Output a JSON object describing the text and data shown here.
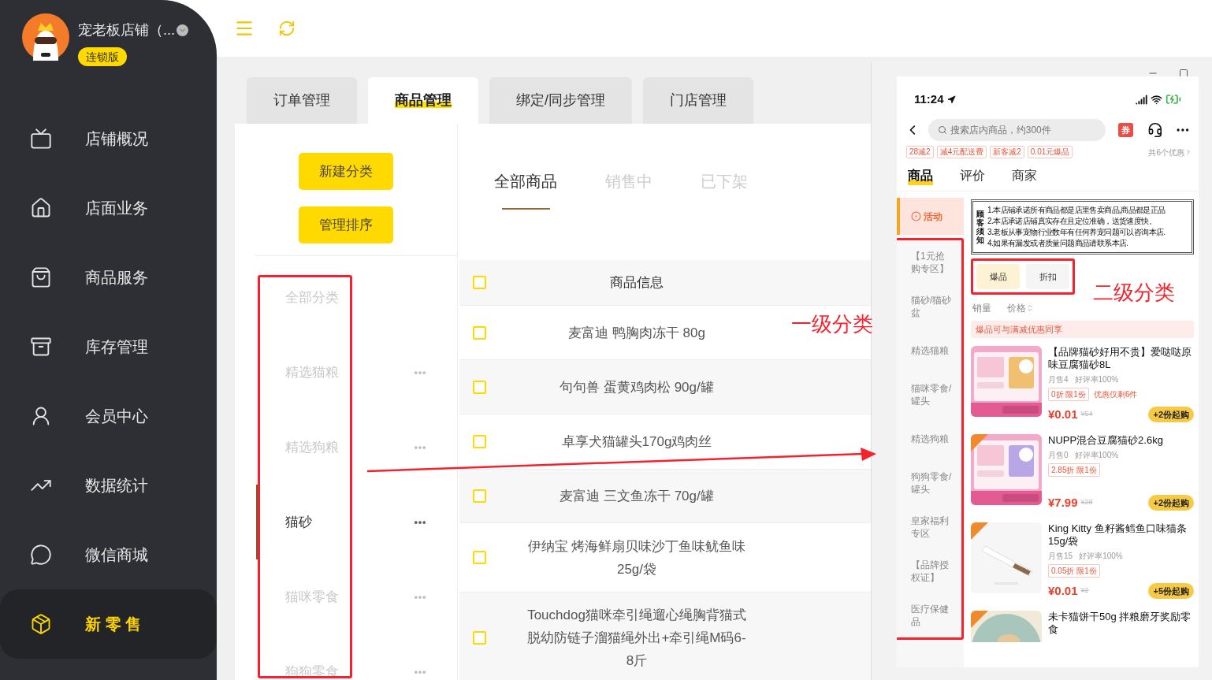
{
  "sidebar": {
    "store_name": "宠老板店铺（...",
    "edition": "连锁版",
    "items": [
      {
        "label": "店铺概况",
        "selected": false
      },
      {
        "label": "店面业务",
        "selected": false
      },
      {
        "label": "商品服务",
        "selected": false
      },
      {
        "label": "库存管理",
        "selected": false
      },
      {
        "label": "会员中心",
        "selected": false
      },
      {
        "label": "数据统计",
        "selected": false
      },
      {
        "label": "微信商城",
        "selected": false
      },
      {
        "label": "新 零 售",
        "selected": true
      }
    ]
  },
  "tabs": [
    {
      "label": "订单管理",
      "selected": false
    },
    {
      "label": "商品管理",
      "selected": true
    },
    {
      "label": "绑定/同步管理",
      "selected": false
    },
    {
      "label": "门店管理",
      "selected": false
    }
  ],
  "category_panel": {
    "buttons": [
      "新建分类",
      "管理排序"
    ],
    "categories": [
      {
        "label": "全部分类",
        "selected": false,
        "has_menu": false
      },
      {
        "label": "精选猫粮",
        "selected": false,
        "has_menu": true
      },
      {
        "label": "精选狗粮",
        "selected": false,
        "has_menu": true
      },
      {
        "label": "猫砂",
        "selected": true,
        "has_menu": true
      },
      {
        "label": "猫咪零食",
        "selected": false,
        "has_menu": true
      },
      {
        "label": "狗狗零食",
        "selected": false,
        "has_menu": true
      }
    ]
  },
  "filter_tabs": [
    {
      "label": "全部商品",
      "selected": true
    },
    {
      "label": "销售中",
      "selected": false
    },
    {
      "label": "已下架",
      "selected": false
    }
  ],
  "table": {
    "all_checked": false,
    "columns": [
      "商品信息"
    ],
    "rows": [
      {
        "name": "麦富迪 鸭胸肉冻干 80g",
        "checked": false
      },
      {
        "name": "句句兽 蛋黄鸡肉松 90g/罐",
        "checked": false
      },
      {
        "name": "卓享犬猫罐头170g鸡肉丝",
        "checked": false
      },
      {
        "name": "麦富迪 三文鱼冻干 70g/罐",
        "checked": false
      },
      {
        "name": "伊纳宝 烤海鲜扇贝味沙丁鱼味鱿鱼味 25g/袋",
        "checked": false
      },
      {
        "name": "Touchdog猫咪牵引绳遛心绳胸背猫式脱幼防链子溜猫绳外出+牵引绳M码6-8斤",
        "checked": false
      }
    ]
  },
  "annotations": [
    {
      "text": "一级分类"
    },
    {
      "text": "二级分类"
    }
  ],
  "phone": {
    "time": "11:24",
    "search_placeholder": "搜索店内商品，约300件",
    "coupon": "券",
    "promos": [
      "28减2",
      "减4元配送费",
      "新客减2",
      "0.01元爆品"
    ],
    "promo_count": "共6个优惠",
    "tabs": [
      {
        "label": "商品",
        "selected": true
      },
      {
        "label": "评价",
        "selected": false
      },
      {
        "label": "商家",
        "selected": false
      }
    ],
    "categories": [
      {
        "label": "活动",
        "selected": true
      },
      {
        "label": "【1元抢购专区】",
        "selected": false
      },
      {
        "label": "猫砂/猫砂盆",
        "selected": false
      },
      {
        "label": "精选猫粮",
        "selected": false
      },
      {
        "label": "猫咪零食/罐头",
        "selected": false
      },
      {
        "label": "精选狗粮",
        "selected": false
      },
      {
        "label": "狗狗零食/罐头",
        "selected": false
      },
      {
        "label": "皇家福利专区",
        "selected": false
      },
      {
        "label": "【品牌授权证】",
        "selected": false
      },
      {
        "label": "医疗保健品",
        "selected": false
      }
    ],
    "notice": {
      "title": "顾客须知",
      "lines": [
        "1.本店铺承诺所有商品都是店里售卖商品,商品都是正品",
        "2.本店承诺店铺真实存在且定位准确，送货速度快。",
        "3.老板从事宠物行业数年有任何养宠问题可以咨询本店.",
        "4.如果有漏发或者质量问题商品请联系本店."
      ]
    },
    "subcategories": [
      {
        "label": "爆品",
        "selected": true
      },
      {
        "label": "折扣",
        "selected": false
      }
    ],
    "sort": [
      "销量",
      "价格"
    ],
    "banner": "爆品可与满减优惠同享",
    "products": [
      {
        "title": "【品牌猫砂好用不贵】爱哒哒原味豆腐猫砂8L",
        "sales": "月售4",
        "rating": "好评率100%",
        "deal": "0折 限1份",
        "stock_note": "优惠仅剩6件",
        "price": "¥0.01",
        "original_price": "¥54",
        "button": "+2份起购"
      },
      {
        "title": "NUPP混合豆腐猫砂2.6kg",
        "sales": "月售0",
        "rating": "好评率100%",
        "deal": "2.85折 限1份",
        "price": "¥7.99",
        "original_price": "¥28",
        "button": "+2份起购"
      },
      {
        "title": "King Kitty 鱼籽酱鳕鱼口味猫条15g/袋",
        "sales": "月售15",
        "rating": "好评率100%",
        "deal": "0.05折 限1份",
        "price": "¥0.01",
        "original_price": "¥2",
        "button": "+5份起购"
      },
      {
        "title": "未卡猫饼干50g 拌粮磨牙奖励零食"
      }
    ]
  }
}
